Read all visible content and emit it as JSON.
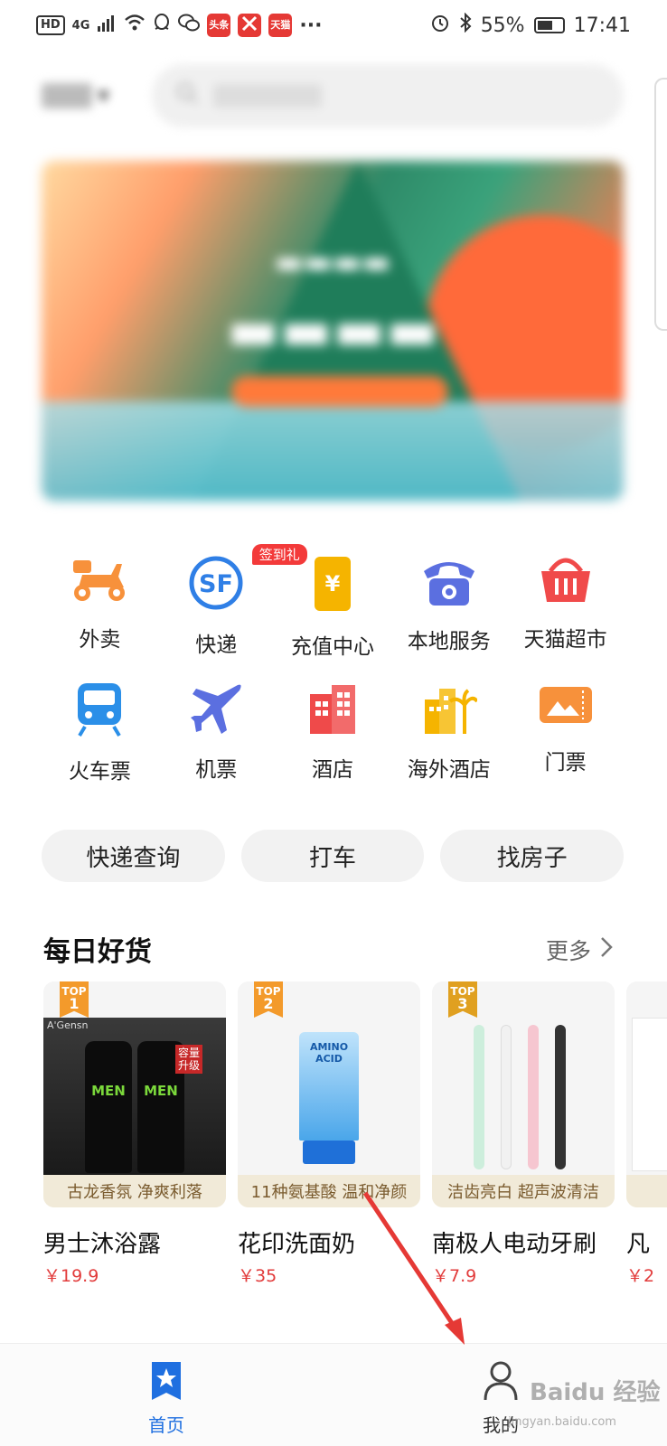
{
  "status_bar": {
    "hd": "HD",
    "network": "4G",
    "badge1": "头条",
    "badge2": "天猫",
    "battery": "55%",
    "time": "17:41",
    "more": "···"
  },
  "services": [
    {
      "label": "外卖",
      "icon": "scooter-icon",
      "color": "#f7913b"
    },
    {
      "label": "快递",
      "icon": "sf-express-icon",
      "color": "#2f7fe6",
      "tag": "签到礼"
    },
    {
      "label": "充值中心",
      "icon": "yen-card-icon",
      "color": "#f5b400"
    },
    {
      "label": "本地服务",
      "icon": "telephone-icon",
      "color": "#5b6fe0"
    },
    {
      "label": "天猫超市",
      "icon": "basket-icon",
      "color": "#f04a4a"
    },
    {
      "label": "火车票",
      "icon": "train-icon",
      "color": "#2b8fe8"
    },
    {
      "label": "机票",
      "icon": "plane-icon",
      "color": "#5b6fe0"
    },
    {
      "label": "酒店",
      "icon": "hotel-icon",
      "color": "#ef4a4a"
    },
    {
      "label": "海外酒店",
      "icon": "palm-hotel-icon",
      "color": "#f5b400"
    },
    {
      "label": "门票",
      "icon": "ticket-icon",
      "color": "#f7913b"
    }
  ],
  "quick_links": [
    "快递查询",
    "打车",
    "找房子"
  ],
  "daily": {
    "title": "每日好货",
    "more": "更多"
  },
  "products": [
    {
      "rank_label": "TOP",
      "rank": "1",
      "slogan": "古龙香氛  净爽利落",
      "name": "男士沐浴露",
      "price": "￥19.9"
    },
    {
      "rank_label": "TOP",
      "rank": "2",
      "slogan": "11种氨基酸  温和净颜",
      "name": "花印洗面奶",
      "price": "￥35"
    },
    {
      "rank_label": "TOP",
      "rank": "3",
      "slogan": "洁齿亮白  超声波清洁",
      "name": "南极人电动牙刷",
      "price": "￥7.9"
    },
    {
      "rank_label": "",
      "rank": "",
      "slogan": "",
      "name": "凡",
      "price": "￥2"
    }
  ],
  "product_art": {
    "p1_brand": "A'Gensn",
    "p1_bottle": "MEN",
    "p1_badge": "容量升级",
    "p2_label": "AMINO ACID"
  },
  "nav": {
    "home": "首页",
    "mine": "我的"
  },
  "watermark": {
    "main": "Baidu 经验",
    "sub": "jingyan.baidu.com"
  },
  "colors": {
    "nav_active": "#1f6fe0",
    "price": "#e23b3b",
    "annotation_arrow": "#e53935"
  }
}
